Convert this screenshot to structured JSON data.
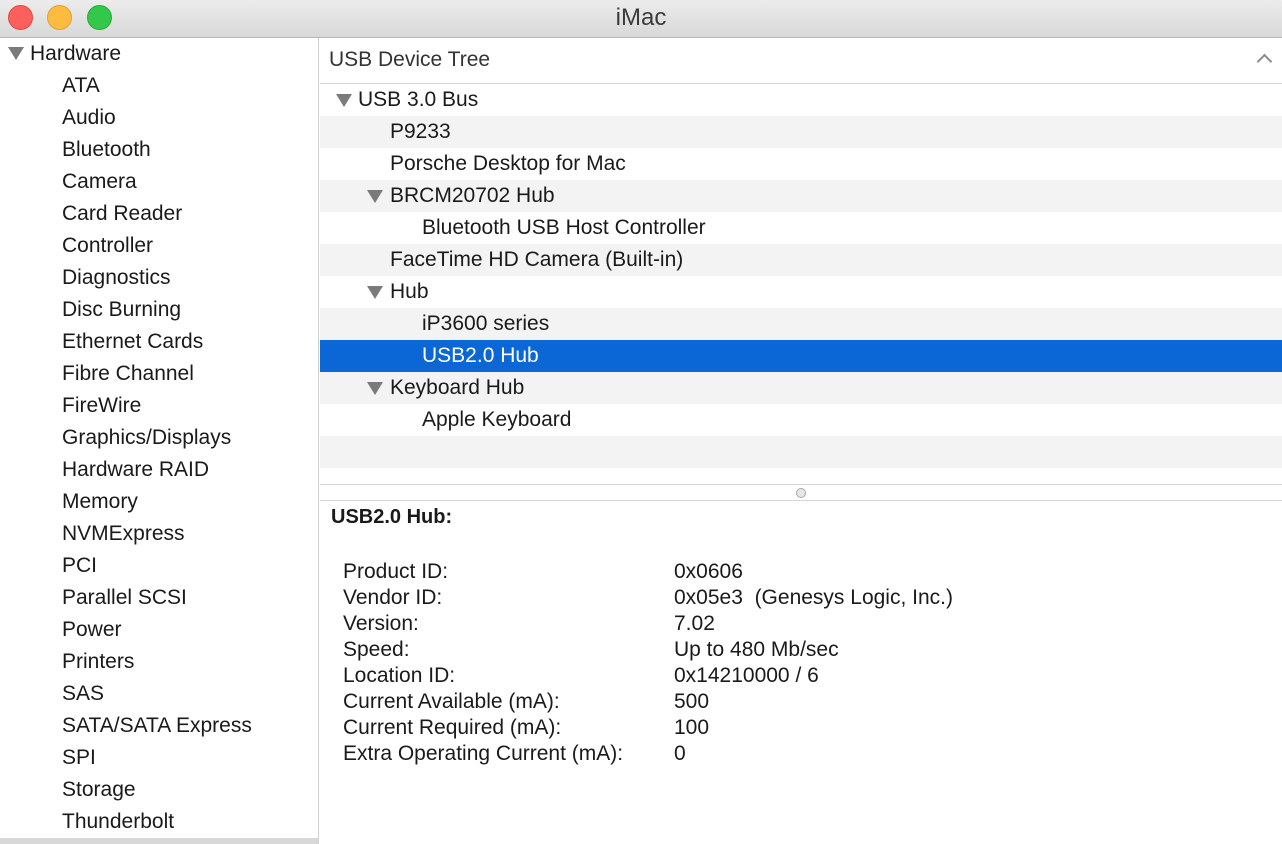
{
  "window": {
    "title": "iMac"
  },
  "sidebar": {
    "section_label": "Hardware",
    "items": [
      "ATA",
      "Audio",
      "Bluetooth",
      "Camera",
      "Card Reader",
      "Controller",
      "Diagnostics",
      "Disc Burning",
      "Ethernet Cards",
      "Fibre Channel",
      "FireWire",
      "Graphics/Displays",
      "Hardware RAID",
      "Memory",
      "NVMExpress",
      "PCI",
      "Parallel SCSI",
      "Power",
      "Printers",
      "SAS",
      "SATA/SATA Express",
      "SPI",
      "Storage",
      "Thunderbolt"
    ]
  },
  "tree": {
    "header": "USB Device Tree",
    "nodes": [
      {
        "label": "USB 3.0 Bus",
        "depth": 0,
        "expandable": true,
        "selected": false
      },
      {
        "label": "P9233",
        "depth": 1,
        "expandable": false,
        "selected": false
      },
      {
        "label": "Porsche Desktop for Mac",
        "depth": 1,
        "expandable": false,
        "selected": false
      },
      {
        "label": "BRCM20702 Hub",
        "depth": 1,
        "expandable": true,
        "selected": false
      },
      {
        "label": "Bluetooth USB Host Controller",
        "depth": 2,
        "expandable": false,
        "selected": false
      },
      {
        "label": "FaceTime HD Camera (Built-in)",
        "depth": 1,
        "expandable": false,
        "selected": false
      },
      {
        "label": "Hub",
        "depth": 1,
        "expandable": true,
        "selected": false
      },
      {
        "label": "iP3600 series",
        "depth": 2,
        "expandable": false,
        "selected": false
      },
      {
        "label": "USB2.0 Hub",
        "depth": 2,
        "expandable": false,
        "selected": true
      },
      {
        "label": "Keyboard Hub",
        "depth": 1,
        "expandable": true,
        "selected": false
      },
      {
        "label": "Apple Keyboard",
        "depth": 2,
        "expandable": false,
        "selected": false
      }
    ]
  },
  "detail": {
    "heading": "USB2.0 Hub:",
    "properties": [
      {
        "key": "Product ID:",
        "value": "0x0606"
      },
      {
        "key": "Vendor ID:",
        "value": "0x05e3  (Genesys Logic, Inc.)"
      },
      {
        "key": "Version:",
        "value": "7.02"
      },
      {
        "key": "Speed:",
        "value": "Up to 480 Mb/sec"
      },
      {
        "key": "Location ID:",
        "value": "0x14210000 / 6"
      },
      {
        "key": "Current Available (mA):",
        "value": "500"
      },
      {
        "key": "Current Required (mA):",
        "value": "100"
      },
      {
        "key": "Extra Operating Current (mA):",
        "value": "0"
      }
    ]
  },
  "colors": {
    "selection": "#0b66d6",
    "close": "#fc605c",
    "minimize": "#fdbc40",
    "maximize": "#34c84a"
  }
}
